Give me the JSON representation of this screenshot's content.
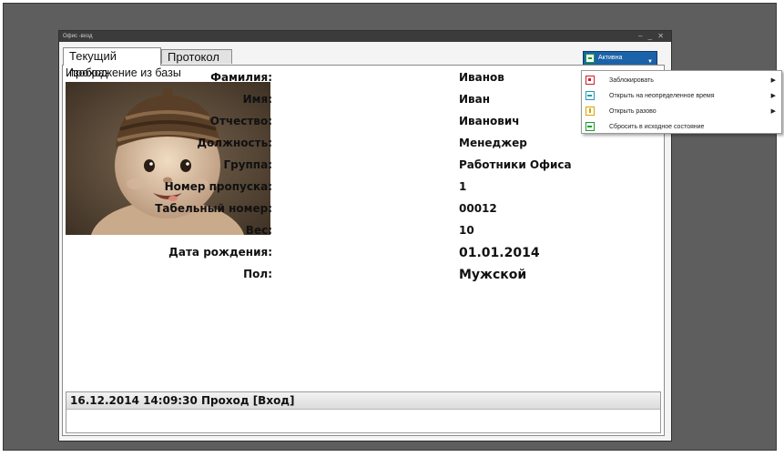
{
  "window": {
    "title": "Офис -вход",
    "controls": "– _ ✕"
  },
  "tabs": [
    {
      "label": "Текущий проход"
    },
    {
      "label": "Протокол"
    }
  ],
  "image_section_label": "Изображение из базы",
  "person": {
    "fields": [
      {
        "label": "Фамилия:",
        "value": "Иванов"
      },
      {
        "label": "Имя:",
        "value": "Иван"
      },
      {
        "label": "Отчество:",
        "value": "Иванович"
      },
      {
        "label": "Должность:",
        "value": "Менеджер"
      },
      {
        "label": "Группа:",
        "value": "Работники Офиса"
      },
      {
        "label": "Номер пропуска:",
        "value": "1"
      },
      {
        "label": "Табельный номер:",
        "value": "00012"
      },
      {
        "label": "Вес:",
        "value": "10"
      },
      {
        "label": "Дата рождения:",
        "value": "01.01.2014"
      },
      {
        "label": "Пол:",
        "value": "Мужской"
      }
    ]
  },
  "events": {
    "latest": "16.12.2014 14:09:30 Проход [Вход]"
  },
  "status_button": {
    "label": "Активна",
    "icon": "active-icon"
  },
  "status_menu": {
    "items": [
      {
        "label": "Заблокировать",
        "icon": "lock-icon",
        "submenu": true
      },
      {
        "label": "Открыть на неопределенное время",
        "icon": "open-icon",
        "submenu": true
      },
      {
        "label": "Открыть разово",
        "icon": "once-icon",
        "submenu": true
      },
      {
        "label": "Сбросить в исходное состояние",
        "icon": "reset-icon",
        "submenu": false
      }
    ],
    "submenu_arrow": "▶"
  },
  "colors": {
    "background": "#5e5e5e",
    "titlebar": "#3b3b3b",
    "status_button": "#1b63a8",
    "status_active": "#1a9c2e",
    "lock": "#d21c2a"
  }
}
